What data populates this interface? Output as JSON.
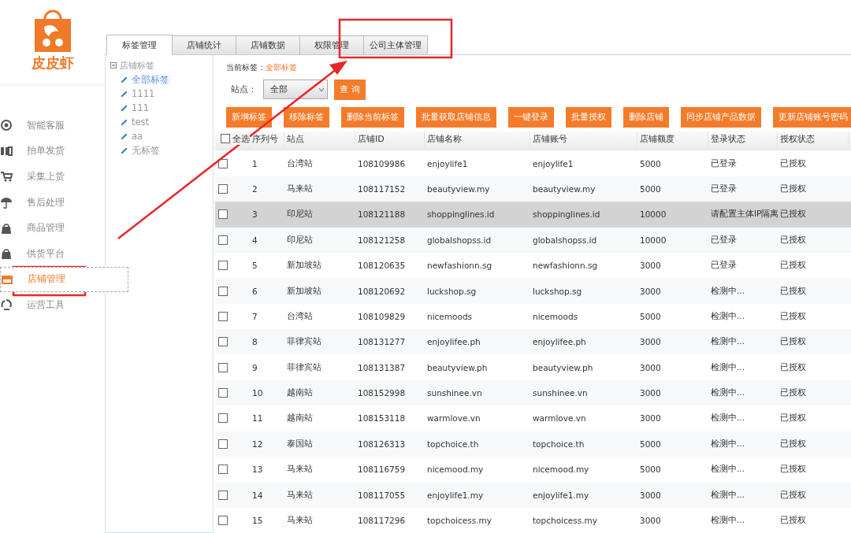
{
  "logo": {
    "text": "皮皮虾"
  },
  "sidebar": {
    "items": [
      {
        "label": "智能客服",
        "selected": false
      },
      {
        "label": "拍单发货",
        "selected": false
      },
      {
        "label": "采集上货",
        "selected": false
      },
      {
        "label": "售后处理",
        "selected": false
      },
      {
        "label": "商品管理",
        "selected": false
      },
      {
        "label": "供货平台",
        "selected": false
      },
      {
        "label": "店铺管理",
        "selected": true
      },
      {
        "label": "运营工具",
        "selected": false
      }
    ]
  },
  "tabs": [
    {
      "label": "标签管理",
      "selected": true
    },
    {
      "label": "店铺统计",
      "selected": false
    },
    {
      "label": "店铺数据",
      "selected": false
    },
    {
      "label": "权限管理",
      "selected": false
    },
    {
      "label": "公司主体管理",
      "selected": false
    }
  ],
  "tag_tree": {
    "label": "店铺标签",
    "expanded": true,
    "children": [
      {
        "label": "全部标签",
        "selected": true
      },
      {
        "label": "1111",
        "selected": false
      },
      {
        "label": "111",
        "selected": false
      },
      {
        "label": "test",
        "selected": false
      },
      {
        "label": "aa",
        "selected": false
      },
      {
        "label": "无标签",
        "selected": false
      }
    ]
  },
  "current_tag": {
    "label": "当前标签：",
    "value": "全部标签"
  },
  "filter": {
    "label": "站点：",
    "value": "全部",
    "button": "查 询"
  },
  "actions": [
    "新增标签",
    "移除标签",
    "删除当前标签",
    "批量获取店铺信息",
    "一键登录",
    "批量授权",
    "删除店铺",
    "同步店铺产品数据",
    "更新店铺账号密码"
  ],
  "table": {
    "select_all": {
      "label": "全选",
      "checked": false
    },
    "columns": [
      "序列号",
      "站点",
      "店铺ID",
      "店铺名称",
      "店铺账号",
      "店铺额度",
      "登录状态",
      "授权状态"
    ],
    "rows": [
      {
        "checked": false,
        "selected": false,
        "cells": [
          "1",
          "台湾站",
          "108109986",
          "enjoylife1",
          "enjoylife1",
          "5000",
          "已登录",
          "已授权"
        ]
      },
      {
        "checked": false,
        "selected": false,
        "cells": [
          "2",
          "马来站",
          "108117152",
          "beautyview.my",
          "beautyview.my",
          "5000",
          "已登录",
          "已授权"
        ]
      },
      {
        "checked": false,
        "selected": true,
        "cells": [
          "3",
          "印尼站",
          "108121188",
          "shoppinglines.id",
          "shoppinglines.id",
          "10000",
          "请配置主体IP隔离",
          "已授权"
        ]
      },
      {
        "checked": false,
        "selected": false,
        "cells": [
          "4",
          "印尼站",
          "108121258",
          "globalshopss.id",
          "globalshopss.id",
          "10000",
          "已登录",
          "已授权"
        ]
      },
      {
        "checked": false,
        "selected": false,
        "cells": [
          "5",
          "新加坡站",
          "108120635",
          "newfashionn.sg",
          "newfashionn.sg",
          "3000",
          "已登录",
          "已授权"
        ]
      },
      {
        "checked": false,
        "selected": false,
        "cells": [
          "6",
          "新加坡站",
          "108120692",
          "luckshop.sg",
          "luckshop.sg",
          "3000",
          "检测中...",
          "已授权"
        ]
      },
      {
        "checked": false,
        "selected": false,
        "cells": [
          "7",
          "台湾站",
          "108109829",
          "nicemoods",
          "nicemoods",
          "5000",
          "检测中...",
          "已授权"
        ]
      },
      {
        "checked": false,
        "selected": false,
        "cells": [
          "8",
          "菲律宾站",
          "108131277",
          "enjoylifee.ph",
          "enjoylifee.ph",
          "3000",
          "检测中...",
          "已授权"
        ]
      },
      {
        "checked": false,
        "selected": false,
        "cells": [
          "9",
          "菲律宾站",
          "108131387",
          "beautyview.ph",
          "beautyview.ph",
          "3000",
          "检测中...",
          "已授权"
        ]
      },
      {
        "checked": false,
        "selected": false,
        "cells": [
          "10",
          "越南站",
          "108152998",
          "sunshinee.vn",
          "sunshinee.vn",
          "3000",
          "检测中...",
          "已授权"
        ]
      },
      {
        "checked": false,
        "selected": false,
        "cells": [
          "11",
          "越南站",
          "108153118",
          "warmlove.vn",
          "warmlove.vn",
          "3000",
          "检测中...",
          "已授权"
        ]
      },
      {
        "checked": false,
        "selected": false,
        "cells": [
          "12",
          "泰国站",
          "108126313",
          "topchoice.th",
          "topchoice.th",
          "5000",
          "检测中...",
          "已授权"
        ]
      },
      {
        "checked": false,
        "selected": false,
        "cells": [
          "13",
          "马来站",
          "108116759",
          "nicemood.my",
          "nicemood.my",
          "5000",
          "检测中...",
          "已授权"
        ]
      },
      {
        "checked": false,
        "selected": false,
        "cells": [
          "14",
          "马来站",
          "108117055",
          "enjoylife1.my",
          "enjoylife1.my",
          "3000",
          "检测中...",
          "已授权"
        ]
      },
      {
        "checked": false,
        "selected": false,
        "cells": [
          "15",
          "马来站",
          "108117296",
          "topchoicess.my",
          "topchoicess.my",
          "3000",
          "检测中...",
          "已授权"
        ]
      }
    ]
  }
}
